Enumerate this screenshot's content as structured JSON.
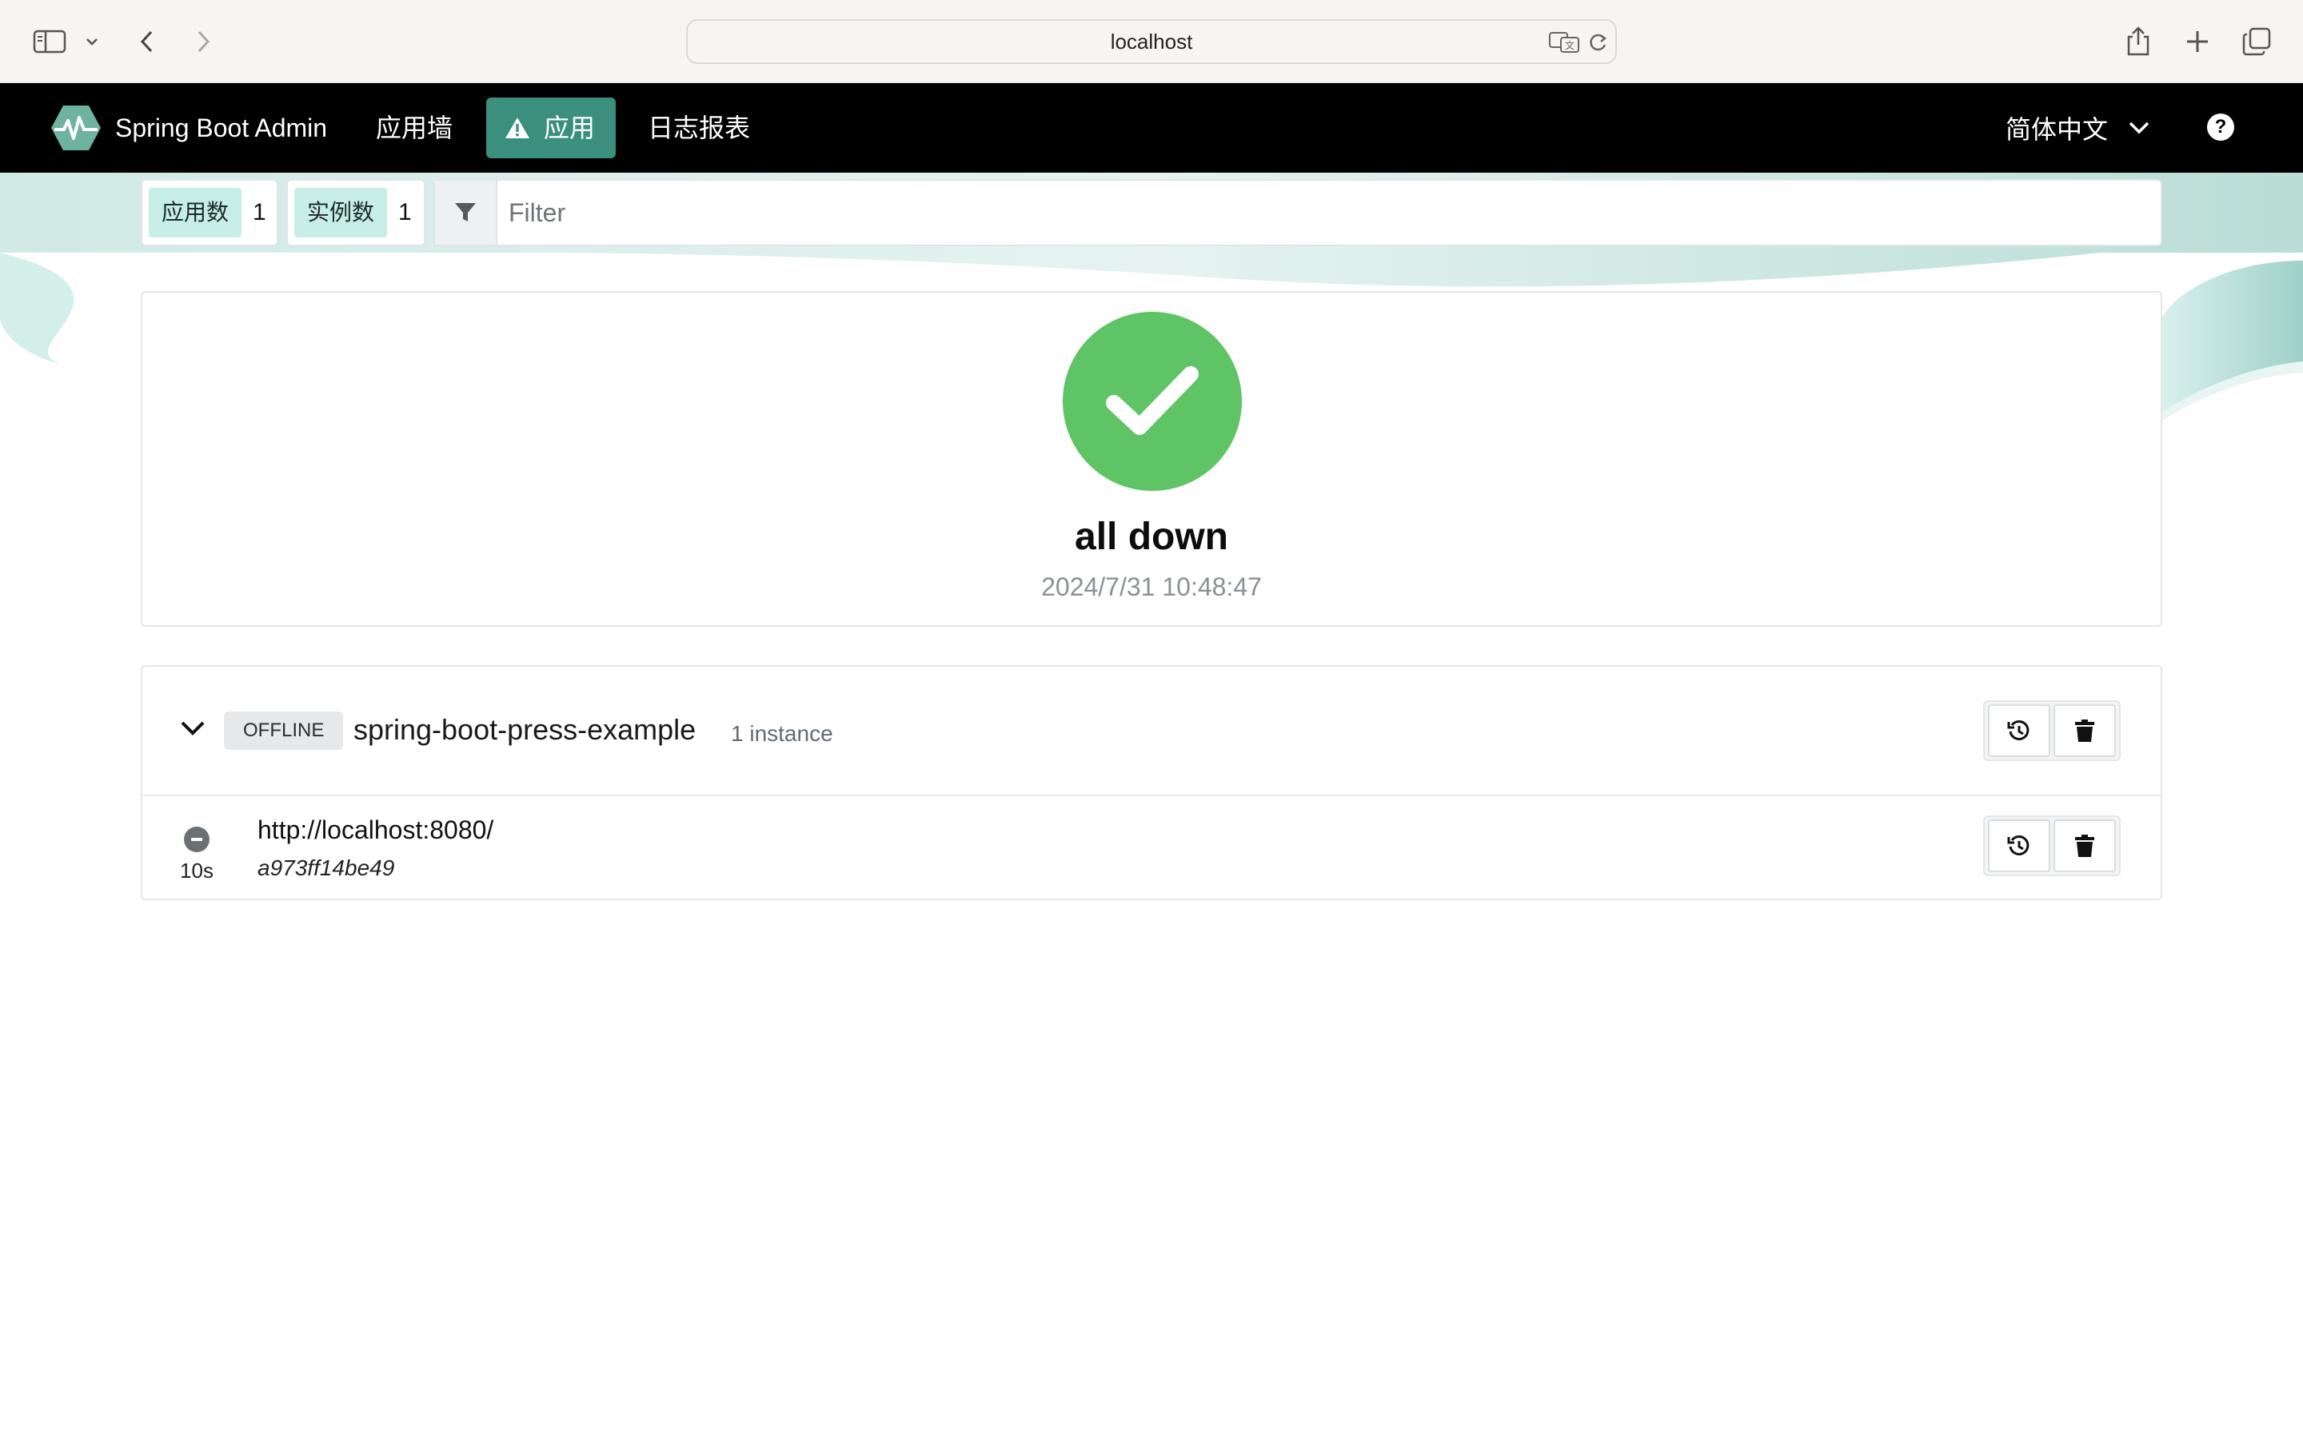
{
  "browser": {
    "url": "localhost"
  },
  "navbar": {
    "brand": "Spring Boot Admin",
    "items": [
      {
        "label": "应用墙"
      },
      {
        "label": "应用",
        "active": true
      },
      {
        "label": "日志报表"
      }
    ],
    "language": "简体中文",
    "help_icon": "question-circle-icon"
  },
  "filterbar": {
    "applications_label": "应用数",
    "applications_count": "1",
    "instances_label": "实例数",
    "instances_count": "1",
    "filter_placeholder": "Filter"
  },
  "status": {
    "title": "all down",
    "timestamp": "2024/7/31 10:48:47",
    "icon": "check-icon",
    "color": "#5ec466"
  },
  "applications": [
    {
      "status": "OFFLINE",
      "name": "spring-boot-press-example",
      "instance_count": "1 instance",
      "instances": [
        {
          "since": "10s",
          "url": "http://localhost:8080/",
          "id": "a973ff14be49"
        }
      ]
    }
  ],
  "colors": {
    "accent": "#3a8f7e",
    "tag_bg": "#c6ede6",
    "navbar_bg": "#000000"
  }
}
